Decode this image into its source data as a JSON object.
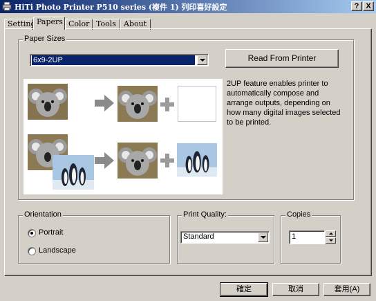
{
  "window": {
    "title": "HiTi Photo Printer P510 series (複件 1) 列印喜好設定",
    "help_button": "?",
    "close_button": "X"
  },
  "tabs": [
    {
      "label": "Setting",
      "active": false
    },
    {
      "label": "Papers",
      "active": true
    },
    {
      "label": "Color",
      "active": false
    },
    {
      "label": "Tools",
      "active": false
    },
    {
      "label": "About",
      "active": false
    }
  ],
  "paper_sizes": {
    "legend": "Paper Sizes",
    "selected": "6x9-2UP",
    "read_button": "Read From Printer",
    "description": "2UP feature enables printer to automatically compose and arrange outputs, depending on how many digital images selected to be printed."
  },
  "orientation": {
    "legend": "Orientation",
    "options": [
      {
        "label": "Portrait",
        "checked": true
      },
      {
        "label": "Landscape",
        "checked": false
      }
    ]
  },
  "print_quality": {
    "legend": "Print Quality:",
    "selected": "Standard"
  },
  "copies": {
    "legend": "Copies",
    "value": "1"
  },
  "footer": {
    "ok": "確定",
    "cancel": "取消",
    "apply": "套用(A)"
  },
  "colors": {
    "title_start": "#0a246a",
    "title_end": "#a6caf0",
    "selection": "#0a246a",
    "face": "#d4d0c8"
  }
}
